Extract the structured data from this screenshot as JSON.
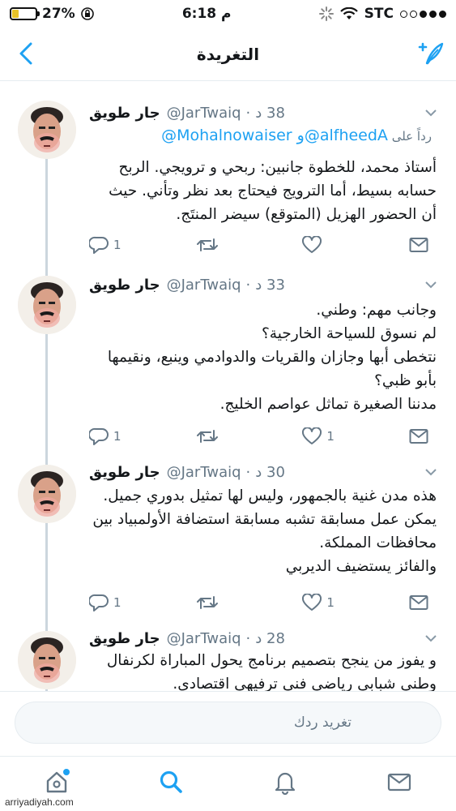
{
  "status_bar": {
    "battery": "27%",
    "battery_level": 0.27,
    "time": "6:18 م",
    "carrier": "STC"
  },
  "header": {
    "title": "التغريدة",
    "back_icon": "chevron-left-icon",
    "compose_icon": "compose-tweet-icon"
  },
  "tweets": [
    {
      "name": "جار طويق",
      "handle": "@JarTwaiq",
      "time": "38 د",
      "reply_prefix": "رداً على",
      "reply_mentions": "@Mohalnowaiser و@alfheedA",
      "lines": [
        "أستاذ محمد، للخطوة جانبين: ربحي و ترويجي. الربح",
        "حسابه بسيط، أما الترويج فيحتاج بعد نظر وتأني. حيث",
        "أن الحضور الهزيل (المتوقع) سيضر المنتَج."
      ],
      "reply_count": "1",
      "like_count": ""
    },
    {
      "name": "جار طويق",
      "handle": "@JarTwaiq",
      "time": "33 د",
      "lines": [
        "وجانب مهم: وطني.",
        "لم نسوق للسياحة الخارجية؟",
        "نتخطى أبها وجازان والقريات والدوادمي وينبع، ونقيمها",
        "بأبو ظبي؟",
        "مدننا الصغيرة تماثل عواصم الخليج."
      ],
      "reply_count": "1",
      "like_count": "1"
    },
    {
      "name": "جار طويق",
      "handle": "@JarTwaiq",
      "time": "30 د",
      "lines": [
        "هذه مدن غنية بالجمهور، وليس لها تمثيل بدوري جميل.",
        "يمكن عمل مسابقة تشبه مسابقة استضافة الأولمبياد بين",
        "محافظات المملكة.",
        "والفائز يستضيف الديربي"
      ],
      "reply_count": "1",
      "like_count": "1"
    },
    {
      "name": "جار طويق",
      "handle": "@JarTwaiq",
      "time": "28 د",
      "lines": [
        "و يفوز من ينجح بتصميم برنامج يحول المباراة لكرنفال",
        "وطني شبابي رياضي فني ترفيهي اقتصادي."
      ],
      "reply_count": "",
      "like_count": ""
    }
  ],
  "reply_bar": {
    "placeholder": "تغريد ردك"
  },
  "tab_bar": {
    "items": [
      "home-icon",
      "search-icon",
      "notifications-icon",
      "messages-icon"
    ]
  },
  "watermark": "arriyadiyah.com"
}
